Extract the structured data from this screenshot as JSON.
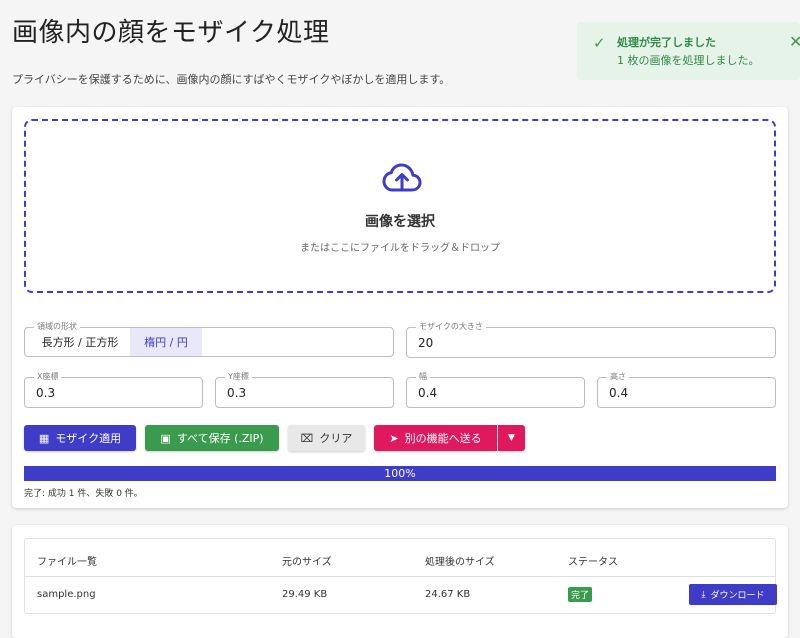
{
  "header": {
    "title": "画像内の顔をモザイク処理",
    "subtitle": "プライバシーを保護するために、画像内の顔にすばやくモザイクやぼかしを適用します。"
  },
  "toast": {
    "title": "処理が完了しました",
    "message": "1 枚の画像を処理しました。",
    "icon": "check-icon",
    "close_icon": "close-icon"
  },
  "upload": {
    "icon": "cloud-upload-icon",
    "title": "画像を選択",
    "hint": "またはここにファイルをドラッグ＆ドロップ"
  },
  "shape": {
    "legend": "領域の形状",
    "options": [
      "長方形 / 正方形",
      "楕円 / 円"
    ],
    "selected": "楕円 / 円"
  },
  "mosaic_size": {
    "legend": "モザイクの大きさ",
    "value": "20"
  },
  "coords": {
    "x": {
      "legend": "X座標",
      "value": "0.3"
    },
    "y": {
      "legend": "Y座標",
      "value": "0.3"
    },
    "width": {
      "legend": "幅",
      "value": "0.4"
    },
    "height": {
      "legend": "高さ",
      "value": "0.4"
    }
  },
  "buttons": {
    "apply": "モザイク適用",
    "save_all": "すべて保存 (.ZIP)",
    "clear": "クリア",
    "send": "別の機能へ送る"
  },
  "progress": {
    "percent": 100,
    "label": "100%"
  },
  "status": "完了: 成功 1 件、失敗 0 件。",
  "table": {
    "headers": [
      "ファイル一覧",
      "元のサイズ",
      "処理後のサイズ",
      "ステータス"
    ],
    "rows": [
      {
        "name": "sample.png",
        "original": "29.49 KB",
        "processed": "24.67 KB",
        "status": "完了",
        "action": "ダウンロード"
      }
    ]
  },
  "colors": {
    "accent": "#3f3dc8",
    "success": "#3a9b4e",
    "pink": "#e0185d",
    "toast_bg": "#e6f3e8"
  }
}
